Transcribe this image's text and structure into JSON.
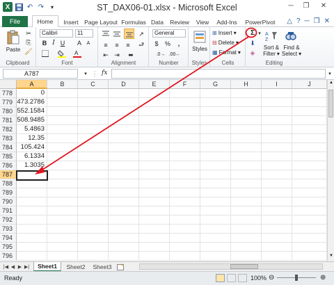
{
  "window": {
    "title": "ST_DAX06-01.xlsx  -  Microsoft Excel",
    "app_icon": "X"
  },
  "tabs": {
    "file": "File",
    "items": [
      "Home",
      "Insert",
      "Page Layout",
      "Formulas",
      "Data",
      "Review",
      "View",
      "Add-Ins",
      "PowerPivot"
    ]
  },
  "ribbon": {
    "clipboard": {
      "paste": "Paste",
      "label": "Clipboard"
    },
    "font": {
      "name": "Calibri",
      "size": "11",
      "label": "Font"
    },
    "alignment": {
      "label": "Alignment"
    },
    "number": {
      "format": "General",
      "label": "Number",
      "currency": "$",
      "percent": "%",
      "comma": ","
    },
    "styles": {
      "label": "Styles"
    },
    "cells": {
      "insert": "Insert",
      "delete": "Delete",
      "format": "Format",
      "label": "Cells"
    },
    "editing": {
      "autosum": "Σ",
      "sort_line1": "Sort &",
      "sort_line2": "Filter",
      "find_line1": "Find &",
      "find_line2": "Select",
      "label": "Editing"
    }
  },
  "formula_bar": {
    "name_box": "A787",
    "fx": "fx",
    "value": ""
  },
  "columns": [
    "A",
    "B",
    "C",
    "D",
    "E",
    "F",
    "G",
    "H",
    "I",
    "J"
  ],
  "rows": [
    {
      "num": "778",
      "a": "0"
    },
    {
      "num": "779",
      "a": "473.2786"
    },
    {
      "num": "780",
      "a": "552.1584"
    },
    {
      "num": "781",
      "a": "508.9485"
    },
    {
      "num": "782",
      "a": "5.4863"
    },
    {
      "num": "783",
      "a": "12.35"
    },
    {
      "num": "784",
      "a": "105.424"
    },
    {
      "num": "785",
      "a": "6.1334"
    },
    {
      "num": "786",
      "a": "1.3035"
    },
    {
      "num": "787",
      "a": ""
    },
    {
      "num": "788",
      "a": ""
    },
    {
      "num": "789",
      "a": ""
    },
    {
      "num": "790",
      "a": ""
    },
    {
      "num": "791",
      "a": ""
    },
    {
      "num": "792",
      "a": ""
    },
    {
      "num": "793",
      "a": ""
    },
    {
      "num": "794",
      "a": ""
    },
    {
      "num": "795",
      "a": ""
    },
    {
      "num": "796",
      "a": ""
    }
  ],
  "active_cell": "A787",
  "sheets": [
    "Sheet1",
    "Sheet2",
    "Sheet3"
  ],
  "active_sheet": "Sheet1",
  "status": {
    "mode": "Ready",
    "zoom": "100%"
  },
  "colors": {
    "accent": "#1f7346",
    "annotation": "#e0141e",
    "selected_header": "#ffd58d"
  }
}
